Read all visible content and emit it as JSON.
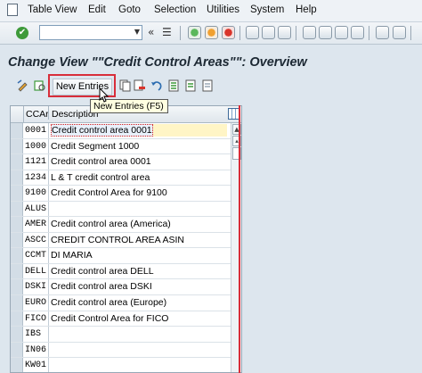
{
  "menu": {
    "items": [
      "Table View",
      "Edit",
      "Goto",
      "Selection",
      "Utilities",
      "System",
      "Help"
    ]
  },
  "toolbar": {
    "command_field_value": "",
    "nav_glyphs": [
      "«",
      "☰"
    ]
  },
  "screen": {
    "title": "Change View \"\"Credit Control Areas\"\": Overview"
  },
  "app_toolbar": {
    "new_entries_label": "New Entries",
    "tooltip": "New Entries   (F5)"
  },
  "table": {
    "columns": [
      "CCAr",
      "Description"
    ],
    "rows": [
      {
        "ccar": "0001",
        "desc": "Credit control area 0001"
      },
      {
        "ccar": "1000",
        "desc": "Credit Segment 1000"
      },
      {
        "ccar": "1121",
        "desc": "Credit control area 0001"
      },
      {
        "ccar": "1234",
        "desc": "L & T credit control area"
      },
      {
        "ccar": "9100",
        "desc": "Credit Control Area for 9100"
      },
      {
        "ccar": "ALUS",
        "desc": ""
      },
      {
        "ccar": "AMER",
        "desc": "Credit control area (America)"
      },
      {
        "ccar": "ASCC",
        "desc": "CREDIT CONTROL AREA ASIN"
      },
      {
        "ccar": "CCMT",
        "desc": "DI MARIA"
      },
      {
        "ccar": "DELL",
        "desc": "Credit control area DELL"
      },
      {
        "ccar": "DSKI",
        "desc": "Credit control area DSKI"
      },
      {
        "ccar": "EURO",
        "desc": "Credit control area (Europe)"
      },
      {
        "ccar": "FICO",
        "desc": "Credit Control Area for FICO"
      },
      {
        "ccar": "IBS",
        "desc": ""
      },
      {
        "ccar": "IN06",
        "desc": ""
      },
      {
        "ccar": "KW01",
        "desc": ""
      }
    ]
  },
  "colors": {
    "highlight": "#d82e3a",
    "ok": "#3e9a3a",
    "background": "#dde6ee"
  }
}
